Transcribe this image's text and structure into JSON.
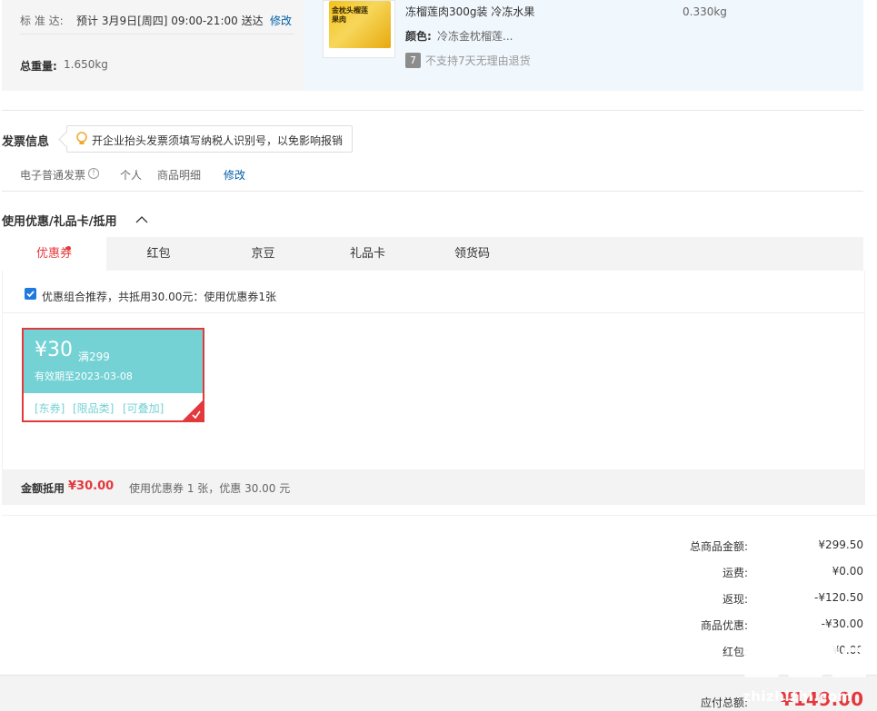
{
  "delivery": {
    "standard_label": "标 准 达:",
    "standard_text": "预计 3月9日[周四] 09:00-21:00 送达",
    "modify": "修改",
    "weight_label": "总重量:",
    "weight_value": "1.650kg"
  },
  "product": {
    "thumb_text": "金枕头榴莲果肉",
    "name": "冻榴莲肉300g装 冷冻水果",
    "color_label": "颜色:",
    "color_value": "冷冻金枕榴莲...",
    "return_icon": "7",
    "return_text": "不支持7天无理由退货",
    "weight": "0.330kg"
  },
  "invoice": {
    "title": "发票信息",
    "tip": "开企业抬头发票须填写纳税人识别号，以免影响报销",
    "type": "电子普通发票",
    "title_type": "个人",
    "content": "商品明细",
    "modify": "修改"
  },
  "discounts": {
    "title": "使用优惠/礼品卡/抵用",
    "tabs": [
      "优惠券",
      "红包",
      "京豆",
      "礼品卡",
      "领货码"
    ],
    "combo_text": "优惠组合推荐，共抵用30.00元：使用优惠券1张",
    "coupon": {
      "amount": "¥30",
      "condition": "满299",
      "validity": "有效期至2023-03-08",
      "tag1": "[东券]",
      "tag2": "[限品类]",
      "tag3": "[可叠加]"
    },
    "summary_label": "金额抵用",
    "summary_amount": "¥30.00",
    "summary_text": "使用优惠券 1 张，优惠 30.00 元"
  },
  "totals": {
    "rows": [
      {
        "label": "总商品金额:",
        "value": "¥299.50"
      },
      {
        "label": "运费:",
        "value": "¥0.00"
      },
      {
        "label": "返现:",
        "value": "-¥120.50"
      },
      {
        "label": "商品优惠:",
        "value": "-¥30.00"
      },
      {
        "label": "红包:",
        "value": "¥0.00"
      }
    ],
    "payable_label": "应付总额:",
    "payable_value": "¥149.00"
  },
  "watermark": {
    "text": "zhizhizhi.com"
  },
  "colors": {
    "accent_red": "#e4393c",
    "link_blue": "#005ea7",
    "coupon_teal": "#74d2d4"
  }
}
